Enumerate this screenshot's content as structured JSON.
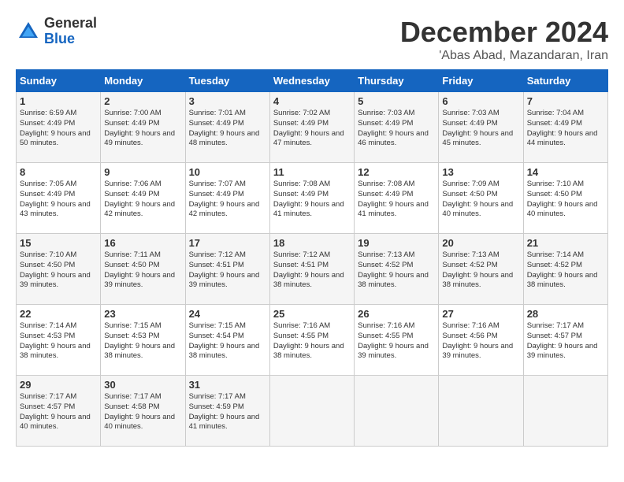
{
  "header": {
    "logo_general": "General",
    "logo_blue": "Blue",
    "month_title": "December 2024",
    "location": "'Abas Abad, Mazandaran, Iran"
  },
  "weekdays": [
    "Sunday",
    "Monday",
    "Tuesday",
    "Wednesday",
    "Thursday",
    "Friday",
    "Saturday"
  ],
  "weeks": [
    [
      {
        "day": "1",
        "sunrise": "6:59 AM",
        "sunset": "4:49 PM",
        "daylight": "9 hours and 50 minutes."
      },
      {
        "day": "2",
        "sunrise": "7:00 AM",
        "sunset": "4:49 PM",
        "daylight": "9 hours and 49 minutes."
      },
      {
        "day": "3",
        "sunrise": "7:01 AM",
        "sunset": "4:49 PM",
        "daylight": "9 hours and 48 minutes."
      },
      {
        "day": "4",
        "sunrise": "7:02 AM",
        "sunset": "4:49 PM",
        "daylight": "9 hours and 47 minutes."
      },
      {
        "day": "5",
        "sunrise": "7:03 AM",
        "sunset": "4:49 PM",
        "daylight": "9 hours and 46 minutes."
      },
      {
        "day": "6",
        "sunrise": "7:03 AM",
        "sunset": "4:49 PM",
        "daylight": "9 hours and 45 minutes."
      },
      {
        "day": "7",
        "sunrise": "7:04 AM",
        "sunset": "4:49 PM",
        "daylight": "9 hours and 44 minutes."
      }
    ],
    [
      {
        "day": "8",
        "sunrise": "7:05 AM",
        "sunset": "4:49 PM",
        "daylight": "9 hours and 43 minutes."
      },
      {
        "day": "9",
        "sunrise": "7:06 AM",
        "sunset": "4:49 PM",
        "daylight": "9 hours and 42 minutes."
      },
      {
        "day": "10",
        "sunrise": "7:07 AM",
        "sunset": "4:49 PM",
        "daylight": "9 hours and 42 minutes."
      },
      {
        "day": "11",
        "sunrise": "7:08 AM",
        "sunset": "4:49 PM",
        "daylight": "9 hours and 41 minutes."
      },
      {
        "day": "12",
        "sunrise": "7:08 AM",
        "sunset": "4:49 PM",
        "daylight": "9 hours and 41 minutes."
      },
      {
        "day": "13",
        "sunrise": "7:09 AM",
        "sunset": "4:50 PM",
        "daylight": "9 hours and 40 minutes."
      },
      {
        "day": "14",
        "sunrise": "7:10 AM",
        "sunset": "4:50 PM",
        "daylight": "9 hours and 40 minutes."
      }
    ],
    [
      {
        "day": "15",
        "sunrise": "7:10 AM",
        "sunset": "4:50 PM",
        "daylight": "9 hours and 39 minutes."
      },
      {
        "day": "16",
        "sunrise": "7:11 AM",
        "sunset": "4:50 PM",
        "daylight": "9 hours and 39 minutes."
      },
      {
        "day": "17",
        "sunrise": "7:12 AM",
        "sunset": "4:51 PM",
        "daylight": "9 hours and 39 minutes."
      },
      {
        "day": "18",
        "sunrise": "7:12 AM",
        "sunset": "4:51 PM",
        "daylight": "9 hours and 38 minutes."
      },
      {
        "day": "19",
        "sunrise": "7:13 AM",
        "sunset": "4:52 PM",
        "daylight": "9 hours and 38 minutes."
      },
      {
        "day": "20",
        "sunrise": "7:13 AM",
        "sunset": "4:52 PM",
        "daylight": "9 hours and 38 minutes."
      },
      {
        "day": "21",
        "sunrise": "7:14 AM",
        "sunset": "4:52 PM",
        "daylight": "9 hours and 38 minutes."
      }
    ],
    [
      {
        "day": "22",
        "sunrise": "7:14 AM",
        "sunset": "4:53 PM",
        "daylight": "9 hours and 38 minutes."
      },
      {
        "day": "23",
        "sunrise": "7:15 AM",
        "sunset": "4:53 PM",
        "daylight": "9 hours and 38 minutes."
      },
      {
        "day": "24",
        "sunrise": "7:15 AM",
        "sunset": "4:54 PM",
        "daylight": "9 hours and 38 minutes."
      },
      {
        "day": "25",
        "sunrise": "7:16 AM",
        "sunset": "4:55 PM",
        "daylight": "9 hours and 38 minutes."
      },
      {
        "day": "26",
        "sunrise": "7:16 AM",
        "sunset": "4:55 PM",
        "daylight": "9 hours and 39 minutes."
      },
      {
        "day": "27",
        "sunrise": "7:16 AM",
        "sunset": "4:56 PM",
        "daylight": "9 hours and 39 minutes."
      },
      {
        "day": "28",
        "sunrise": "7:17 AM",
        "sunset": "4:57 PM",
        "daylight": "9 hours and 39 minutes."
      }
    ],
    [
      {
        "day": "29",
        "sunrise": "7:17 AM",
        "sunset": "4:57 PM",
        "daylight": "9 hours and 40 minutes."
      },
      {
        "day": "30",
        "sunrise": "7:17 AM",
        "sunset": "4:58 PM",
        "daylight": "9 hours and 40 minutes."
      },
      {
        "day": "31",
        "sunrise": "7:17 AM",
        "sunset": "4:59 PM",
        "daylight": "9 hours and 41 minutes."
      },
      null,
      null,
      null,
      null
    ]
  ]
}
